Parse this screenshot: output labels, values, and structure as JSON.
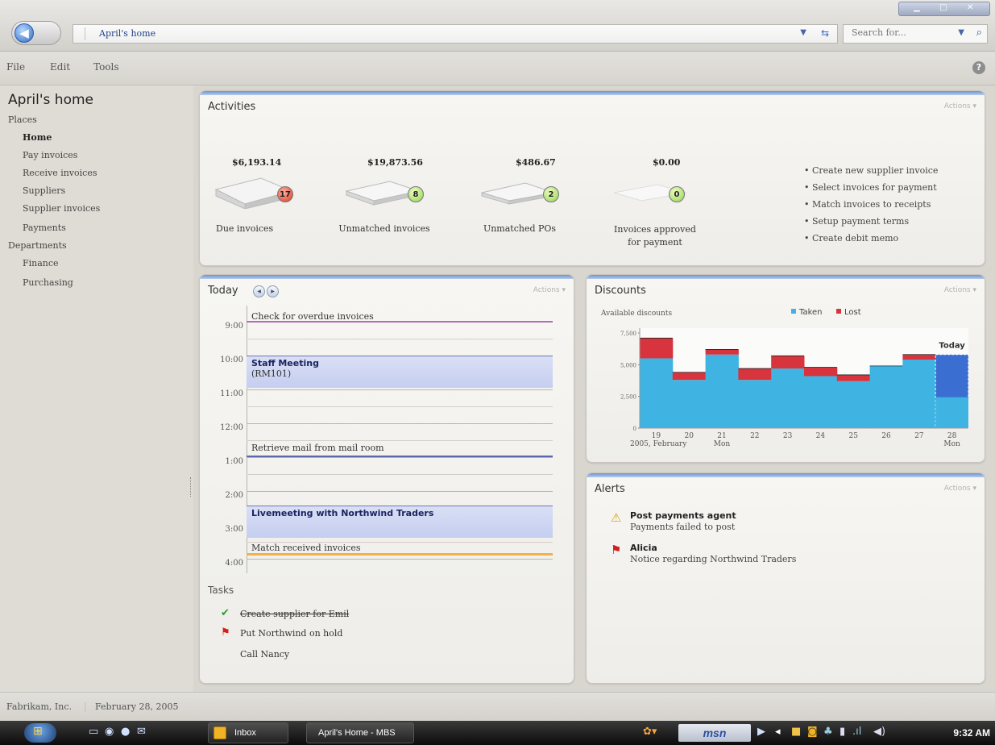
{
  "window": {
    "address": "April's home",
    "search_placeholder": "Search for...",
    "menu": [
      "File",
      "Edit",
      "Tools"
    ]
  },
  "nav": {
    "title": "April's home",
    "groups": {
      "places": "Places",
      "departments": "Departments"
    },
    "places_items": [
      "Home",
      "Pay invoices",
      "Receive invoices",
      "Suppliers",
      "Supplier invoices",
      "Payments"
    ],
    "department_items": [
      "Finance",
      "Purchasing"
    ]
  },
  "activities": {
    "title": "Activities",
    "actions": "Actions ▾",
    "items": [
      {
        "amount": "$6,193.14",
        "count": "17",
        "label": "Due invoices",
        "badge_color": "#d83a22"
      },
      {
        "amount": "$19,873.56",
        "count": "8",
        "label": "Unmatched invoices",
        "badge_color": "#8cd04a"
      },
      {
        "amount": "$486.67",
        "count": "2",
        "label": "Unmatched POs",
        "badge_color": "#8cd04a"
      },
      {
        "amount": "$0.00",
        "count": "0",
        "label": "Invoices approved for payment",
        "badge_color": "#8cd04a"
      }
    ],
    "links": [
      "• Create new supplier invoice",
      "• Select invoices for payment",
      "• Match invoices to receipts",
      "• Setup payment terms",
      "• Create debit memo"
    ]
  },
  "today": {
    "title": "Today",
    "actions": "Actions ▾",
    "hours": [
      "9:00",
      "10:00",
      "11:00",
      "12:00",
      "1:00",
      "2:00",
      "3:00",
      "4:00"
    ],
    "events": {
      "overdue": "Check for overdue invoices",
      "staff_title": "Staff Meeting",
      "staff_room": "(RM101)",
      "mail": "Retrieve mail from mail room",
      "livemeeting": "Livemeeting with Northwind Traders",
      "match": "Match received invoices"
    },
    "tasks_title": "Tasks",
    "tasks": [
      {
        "text": "Create supplier for Emil",
        "status": "done"
      },
      {
        "text": "Put Northwind on hold",
        "status": "flagged"
      },
      {
        "text": "Call Nancy",
        "status": "open"
      }
    ]
  },
  "discounts": {
    "title": "Discounts",
    "actions": "Actions ▾",
    "subtitle": "Available discounts",
    "today_label": "Today"
  },
  "chart_data": {
    "type": "area",
    "title": "Available discounts",
    "categories": [
      "19",
      "20",
      "21",
      "22",
      "23",
      "24",
      "25",
      "26",
      "27",
      "28"
    ],
    "category_sub": [
      "2005, February",
      "",
      "Mon",
      "",
      "",
      "",
      "",
      "",
      "",
      "Mon"
    ],
    "ylim": [
      0,
      7500
    ],
    "yticks": [
      "0",
      "2,500",
      "5,000",
      "7,500"
    ],
    "series": [
      {
        "name": "Taken",
        "color": "#3fb4e3",
        "values": [
          5500,
          3800,
          5800,
          3800,
          4700,
          4100,
          3700,
          4900,
          5400,
          5800
        ]
      },
      {
        "name": "Lost",
        "color": "#d8343e",
        "values": [
          1600,
          600,
          400,
          900,
          1000,
          700,
          500,
          0,
          400,
          0
        ]
      }
    ],
    "legend": "top-right",
    "highlight": "28"
  },
  "alerts": {
    "title": "Alerts",
    "actions": "Actions ▾",
    "items": [
      {
        "title": "Post payments agent",
        "sub": "Payments failed to post",
        "icon": "warning-icon"
      },
      {
        "title": "Alicia",
        "sub": "Notice regarding Northwind Traders",
        "icon": "flag-icon"
      }
    ]
  },
  "status": {
    "company": "Fabrikam, Inc.",
    "date": "February 28, 2005"
  },
  "taskbar": {
    "inbox": "Inbox",
    "app": "April's Home - MBS",
    "msn": "msn",
    "clock": "9:32 AM"
  }
}
